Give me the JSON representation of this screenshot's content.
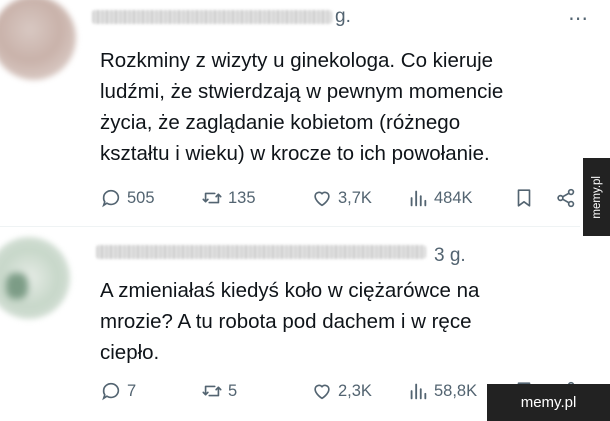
{
  "posts": [
    {
      "time": "g.",
      "more_icon": "more-dots-icon",
      "text": "Rozkminy z wizyty u ginekologa. Co kieruje\nludźmi, że stwierdzają w pewnym momencie\nżycia, że zaglądanie kobietom (różnego\nkształtu i wieku) w krocze to ich powołanie.",
      "replies": "505",
      "reposts": "135",
      "likes": "3,7K",
      "views": "484K"
    },
    {
      "time": "3 g.",
      "text": "A zmieniałaś kiedyś koło w ciężarówce na\nmrozie? A tu robota pod dachem i w ręce\nciepło.",
      "replies": "7",
      "reposts": "5",
      "likes": "2,3K",
      "views": "58,8K"
    }
  ],
  "icons": {
    "reply": "reply-bubble-icon",
    "repost": "repost-arrows-icon",
    "like": "heart-icon",
    "views": "views-bar-chart-icon",
    "bookmark": "bookmark-icon",
    "share": "share-icon"
  },
  "watermark": {
    "side": "memy.pl",
    "corner": "memy.pl"
  },
  "colors": {
    "text": "#0f1419",
    "secondary": "#536471",
    "watermark_bg": "#222222"
  }
}
